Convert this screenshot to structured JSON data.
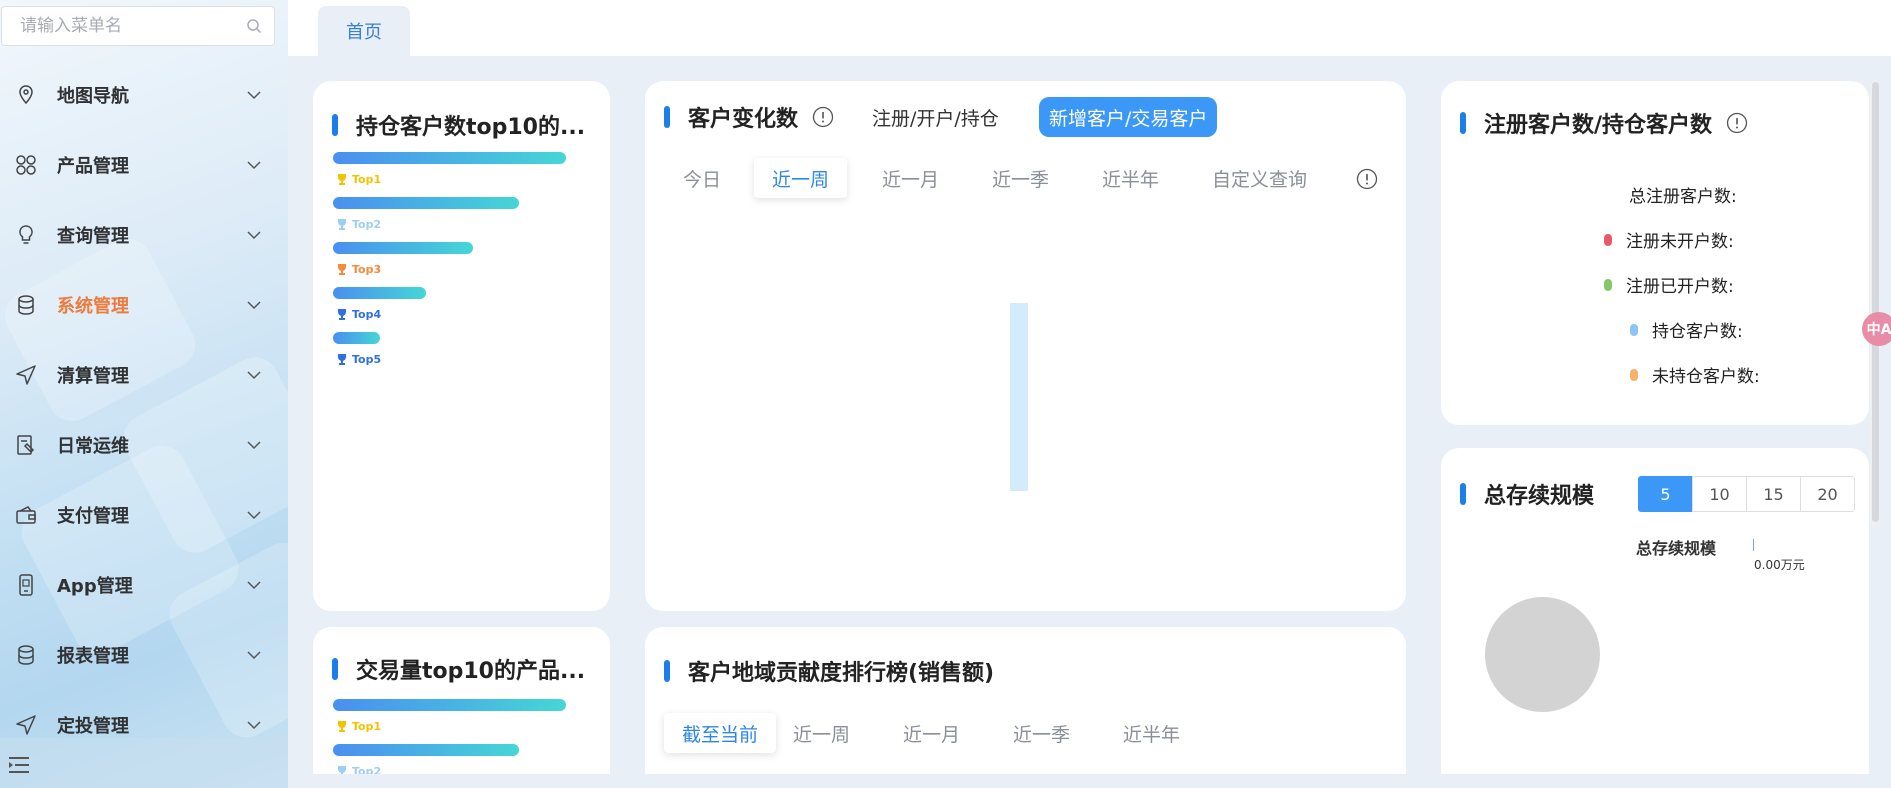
{
  "search": {
    "placeholder": "请输入菜单名"
  },
  "sidebar": {
    "items": [
      {
        "label": "地图导航",
        "icon": "map-pin-icon"
      },
      {
        "label": "产品管理",
        "icon": "grid-icon"
      },
      {
        "label": "查询管理",
        "icon": "bulb-icon"
      },
      {
        "label": "系统管理",
        "icon": "database-icon",
        "active": true
      },
      {
        "label": "清算管理",
        "icon": "send-icon"
      },
      {
        "label": "日常运维",
        "icon": "tool-doc-icon"
      },
      {
        "label": "支付管理",
        "icon": "wallet-icon"
      },
      {
        "label": "App管理",
        "icon": "phone-icon"
      },
      {
        "label": "报表管理",
        "icon": "database-icon"
      },
      {
        "label": "定投管理",
        "icon": "send-icon"
      }
    ]
  },
  "tabs": {
    "home": "首页"
  },
  "holdings_top10": {
    "title": "持仓客户数top10的...",
    "bars": [
      1.0,
      0.8,
      0.6,
      0.4,
      0.2
    ],
    "ranks": [
      {
        "label": "Top1",
        "color": "#f2c300"
      },
      {
        "label": "Top2",
        "color": "#9fcef5"
      },
      {
        "label": "Top3",
        "color": "#f5893c"
      },
      {
        "label": "Top4",
        "color": "#2f6fdf"
      },
      {
        "label": "Top5",
        "color": "#2f6fdf"
      }
    ]
  },
  "trade_top10": {
    "title": "交易量top10的产品...",
    "bars": [
      1.0,
      0.8
    ],
    "ranks": [
      {
        "label": "Top1",
        "color": "#f2c300"
      },
      {
        "label": "Top2",
        "color": "#9fcef5"
      }
    ]
  },
  "customer_change": {
    "title": "客户变化数",
    "toggles": [
      "注册/开户/持仓",
      "新增客户/交易客户"
    ],
    "selected_toggle": 1,
    "periods": [
      "今日",
      "近一周",
      "近一月",
      "近一季",
      "近半年",
      "自定义查询"
    ],
    "selected_period": 1
  },
  "region_rank": {
    "title": "客户地域贡献度排行榜(销售额)",
    "periods": [
      "截至当前",
      "近一周",
      "近一月",
      "近一季",
      "近半年"
    ],
    "selected_period": 0
  },
  "registered": {
    "title": "注册客户数/持仓客户数",
    "legend": [
      {
        "label": "总注册客户数:",
        "color": ""
      },
      {
        "label": "注册未开户数:",
        "color": "#e8596b"
      },
      {
        "label": "注册已开户数:",
        "color": "#86c76a"
      },
      {
        "label": "持仓客户数:",
        "color": "#8cc4f3"
      },
      {
        "label": "未持仓客户数:",
        "color": "#f5b26b"
      }
    ]
  },
  "total_scale": {
    "title": "总存续规模",
    "sizes": [
      "5",
      "10",
      "15",
      "20"
    ],
    "selected_size": 0,
    "label": "总存续规模",
    "value": "0.00万元"
  },
  "translate": {
    "label": "中A"
  }
}
